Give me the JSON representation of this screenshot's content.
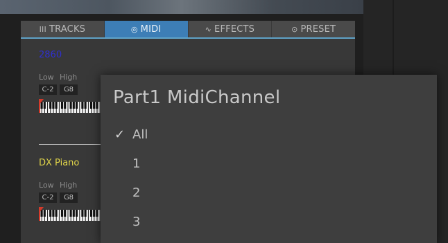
{
  "tabs": [
    {
      "icon": "III",
      "label": "TRACKS",
      "active": false
    },
    {
      "icon": "◎",
      "label": "MIDI",
      "active": true
    },
    {
      "icon": "∿",
      "label": "EFFECTS",
      "active": false
    },
    {
      "icon": "⊙",
      "label": "PRESET",
      "active": false
    }
  ],
  "tracks": [
    {
      "name": "2860",
      "name_color": "#2f2fd0",
      "low_label": "Low",
      "high_label": "High",
      "low": "C-2",
      "high": "G8"
    },
    {
      "name": "DX Piano",
      "name_color": "#e2d64a",
      "low_label": "Low",
      "high_label": "High",
      "low": "C-2",
      "high": "G8"
    }
  ],
  "popup": {
    "title": "Part1 MidiChannel",
    "check_glyph": "✓",
    "options": [
      {
        "label": "All",
        "selected": true
      },
      {
        "label": "1",
        "selected": false
      },
      {
        "label": "2",
        "selected": false
      },
      {
        "label": "3",
        "selected": false
      }
    ]
  },
  "colors": {
    "accent": "#3d7eb6",
    "range_marker": "#d43b2b"
  }
}
